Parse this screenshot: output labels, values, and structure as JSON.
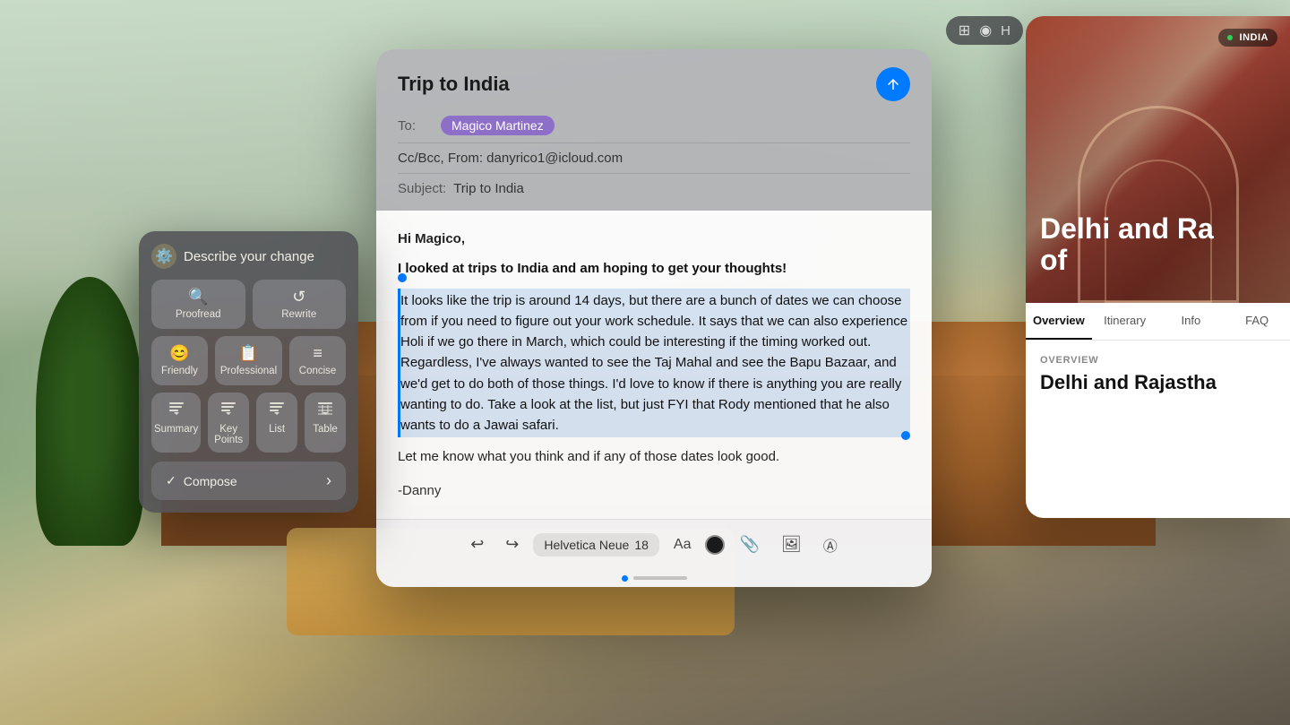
{
  "background": {
    "color": "#8fa87a"
  },
  "email": {
    "title": "Trip to India",
    "to_label": "To:",
    "recipient": "Magico Martinez",
    "cc_line": "Cc/Bcc, From: danyrico1@icloud.com",
    "subject_label": "Subject:",
    "subject": "Trip to India",
    "body_greeting": "Hi Magico,",
    "body_line1": "I looked at trips to India and am hoping to get your thoughts!",
    "body_selected": "It looks like the trip is around 14 days, but there are a bunch of dates we can choose from if you need to figure out your work schedule. It says that we can also experience Holi if we go there in March, which could be interesting if the timing worked out. Regardless, I've always wanted to see the Taj Mahal and see the Bapu Bazaar, and we'd get to do both of those things.  I'd love to know if there is anything you are really wanting to do. Take a look at the list, but just FYI that Rody mentioned that he also wants to do a Jawai safari.",
    "body_p2": "Let me know what you think and if any of those dates look good.",
    "body_sig": "-Danny",
    "toolbar_font": "Helvetica Neue",
    "toolbar_size": "18",
    "send_icon": "↑"
  },
  "writing_tools": {
    "header_text": "Describe your change",
    "gear_icon": "⚙️",
    "buttons": {
      "proofread_label": "Proofread",
      "proofread_icon": "🔍",
      "rewrite_label": "Rewrite",
      "rewrite_icon": "↺",
      "friendly_label": "Friendly",
      "friendly_icon": "😊",
      "professional_label": "Professional",
      "professional_icon": "📋",
      "concise_label": "Concise",
      "concise_icon": "≡",
      "summary_label": "Summary",
      "summary_icon": "↓",
      "keypoints_label": "Key Points",
      "keypoints_icon": "↓",
      "list_label": "List",
      "list_icon": "↓",
      "table_label": "Table",
      "table_icon": "↓"
    },
    "compose_label": "Compose",
    "compose_check": "✓",
    "compose_chevron": "›"
  },
  "travel": {
    "india_badge": "INDIA",
    "hero_title": "Delhi and Ra",
    "hero_subtitle": "of",
    "nav_items": [
      "Overview",
      "Itinerary",
      "Info",
      "FAQ"
    ],
    "active_nav": "Overview",
    "overview_label": "OVERVIEW",
    "overview_title": "Delhi and Rajastha"
  },
  "page_indicator": {
    "dots": 2
  }
}
